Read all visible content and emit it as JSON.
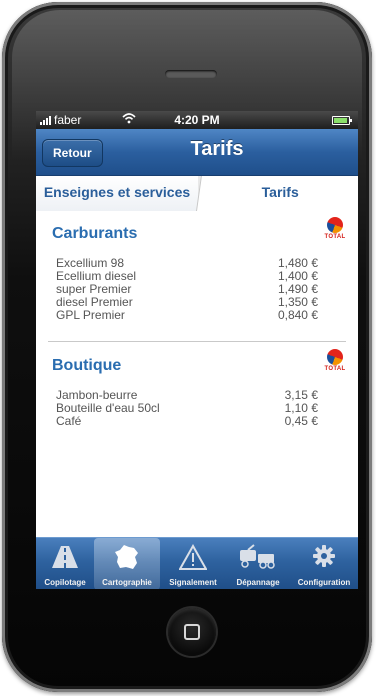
{
  "status_bar": {
    "carrier": "faber",
    "time": "4:20 PM",
    "wifi_icon": "wifi-icon",
    "battery_icon": "battery-icon"
  },
  "nav": {
    "back_label": "Retour",
    "title": "Tarifs"
  },
  "tabs": [
    {
      "label": "Enseignes et services",
      "active": false
    },
    {
      "label": "Tarifs",
      "active": true
    }
  ],
  "sections": [
    {
      "title": "Carburants",
      "logo": "TOTAL",
      "items": [
        {
          "name": "Excellium 98",
          "price": "1,480 €"
        },
        {
          "name": "Ecellium diesel",
          "price": "1,400 €"
        },
        {
          "name": "super Premier",
          "price": "1,490 €"
        },
        {
          "name": "diesel Premier",
          "price": "1,350 €"
        },
        {
          "name": "GPL Premier",
          "price": "0,840 €"
        }
      ]
    },
    {
      "title": "Boutique",
      "logo": "TOTAL",
      "items": [
        {
          "name": "Jambon-beurre",
          "price": "3,15 €"
        },
        {
          "name": "Bouteille d'eau 50cl",
          "price": "1,10 €"
        },
        {
          "name": "Café",
          "price": "0,45 €"
        }
      ]
    }
  ],
  "toolbar": [
    {
      "label": "Copilotage",
      "icon": "road-icon",
      "active": false
    },
    {
      "label": "Cartographie",
      "icon": "france-map-icon",
      "active": true
    },
    {
      "label": "Signalement",
      "icon": "warning-icon",
      "active": false
    },
    {
      "label": "Dépannage",
      "icon": "tow-truck-icon",
      "active": false
    },
    {
      "label": "Configuration",
      "icon": "gear-icon",
      "active": false
    }
  ],
  "colors": {
    "nav_blue": "#2b5f9f",
    "section_title": "#2a6db0",
    "total_red": "#e3241b",
    "total_orange": "#f39200"
  }
}
